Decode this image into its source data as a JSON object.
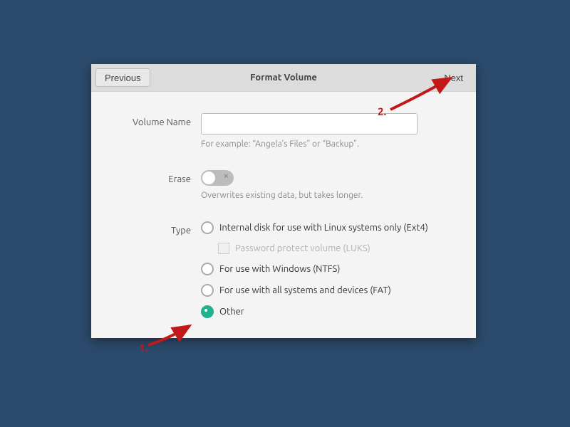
{
  "dialog": {
    "title": "Format Volume",
    "previous": "Previous",
    "next": "Next"
  },
  "volume_name": {
    "label": "Volume Name",
    "value": "",
    "hint": "For example: “Angela’s Files” or “Backup”."
  },
  "erase": {
    "label": "Erase",
    "on": false,
    "hint": "Overwrites existing data, but takes longer."
  },
  "type": {
    "label": "Type",
    "options": [
      {
        "label": "Internal disk for use with Linux systems only (Ext4)",
        "selected": false
      },
      {
        "label": "Password protect volume (LUKS)",
        "is_sub": true,
        "enabled": false,
        "checked": false
      },
      {
        "label": "For use with Windows (NTFS)",
        "selected": false
      },
      {
        "label": "For use with all systems and devices (FAT)",
        "selected": false
      },
      {
        "label": "Other",
        "selected": true
      }
    ]
  },
  "annotations": {
    "step1": "1.",
    "step2": "2."
  }
}
